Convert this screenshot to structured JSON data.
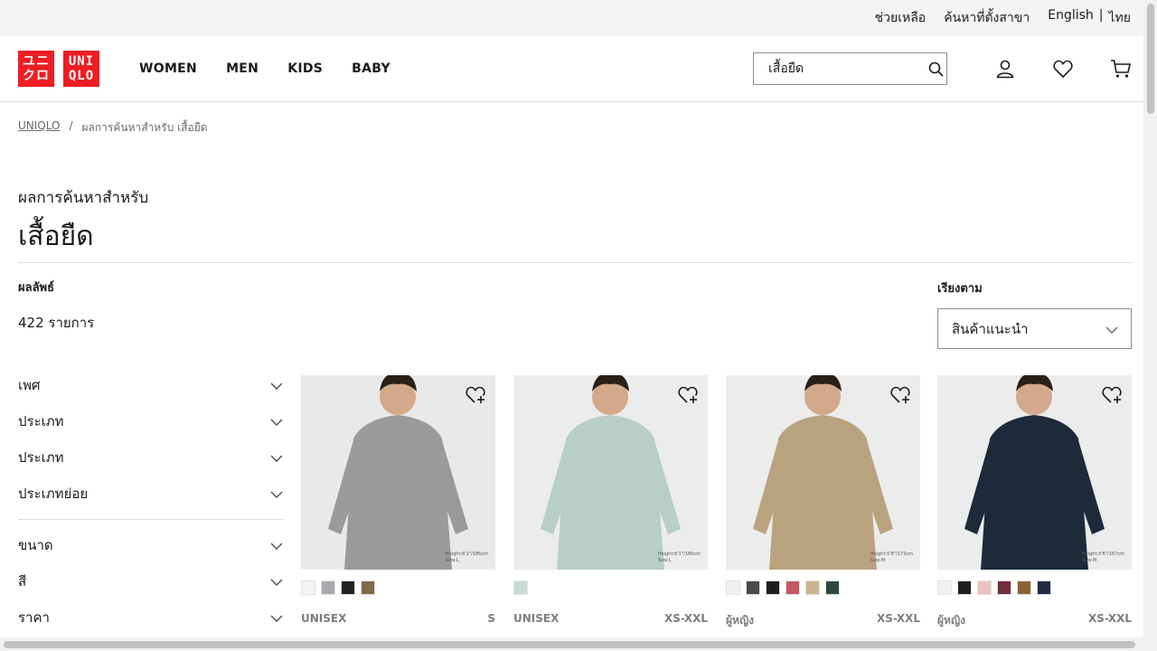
{
  "utility": {
    "help": "ช่วยเหลือ",
    "store_finder": "ค้นหาที่ตั้งสาขา",
    "lang_en": "English",
    "lang_sep": "|",
    "lang_th": "ไทย"
  },
  "logo": {
    "top_kana": "ユニ",
    "bottom_kana": "クロ",
    "top_latin": "UNI",
    "bottom_latin": "QLO"
  },
  "nav": {
    "women": "WOMEN",
    "men": "MEN",
    "kids": "KIDS",
    "baby": "BABY"
  },
  "search": {
    "value": "เสื้อยืด"
  },
  "breadcrumb": {
    "home": "UNIQLO",
    "sep": "/",
    "current": "ผลการค้นหาสำหรับ เสื้อยืด"
  },
  "heading": {
    "subtitle": "ผลการค้นหาสำหรับ",
    "title": "เสื้อยืด"
  },
  "results": {
    "label": "ผลลัพธ์",
    "count": "422 รายการ"
  },
  "sort": {
    "label": "เรียงตาม",
    "selected": "สินค้าแนะนำ"
  },
  "filters": [
    {
      "label": "เพศ"
    },
    {
      "label": "ประเภท"
    },
    {
      "label": "ประเภท"
    },
    {
      "label": "ประเภทย่อย"
    },
    {
      "label": "ขนาด"
    },
    {
      "label": "สี"
    },
    {
      "label": "ราคา"
    }
  ],
  "products": [
    {
      "gender": "UNISEX",
      "size": "S",
      "caption1": "Height:6'1\"/186cm",
      "caption2": "Size:L",
      "bg": "#e9e9e9",
      "garment": "#9a9a9a",
      "swatches": [
        "#f3f3f3",
        "#a9a9ad",
        "#222222",
        "#7f6b45"
      ]
    },
    {
      "gender": "UNISEX",
      "size": "XS-XXL",
      "caption1": "Height:6'1\"/186cm",
      "caption2": "Size:L",
      "bg": "#ececec",
      "garment": "#b7cfc5",
      "swatches": [
        "#c9dcd3"
      ]
    },
    {
      "gender": "ผู้หญิง",
      "size": "XS-XXL",
      "caption1": "Height:5'8\"/173cm",
      "caption2": "Size:M",
      "bg": "#ececec",
      "garment": "#b9a37f",
      "swatches": [
        "#f0f0f0",
        "#4a4a4a",
        "#1f1f1f",
        "#c45a60",
        "#c8b48f",
        "#2e4a3b"
      ]
    },
    {
      "gender": "ผู้หญิง",
      "size": "XS-XXL",
      "caption1": "Height:5'6\"/167cm",
      "caption2": "Size:M",
      "bg": "#ececec",
      "garment": "#1c2a3a",
      "swatches": [
        "#f1f1f1",
        "#1f1f1f",
        "#eac2c3",
        "#6f2f3f",
        "#8d6336",
        "#1f2c42"
      ]
    }
  ]
}
